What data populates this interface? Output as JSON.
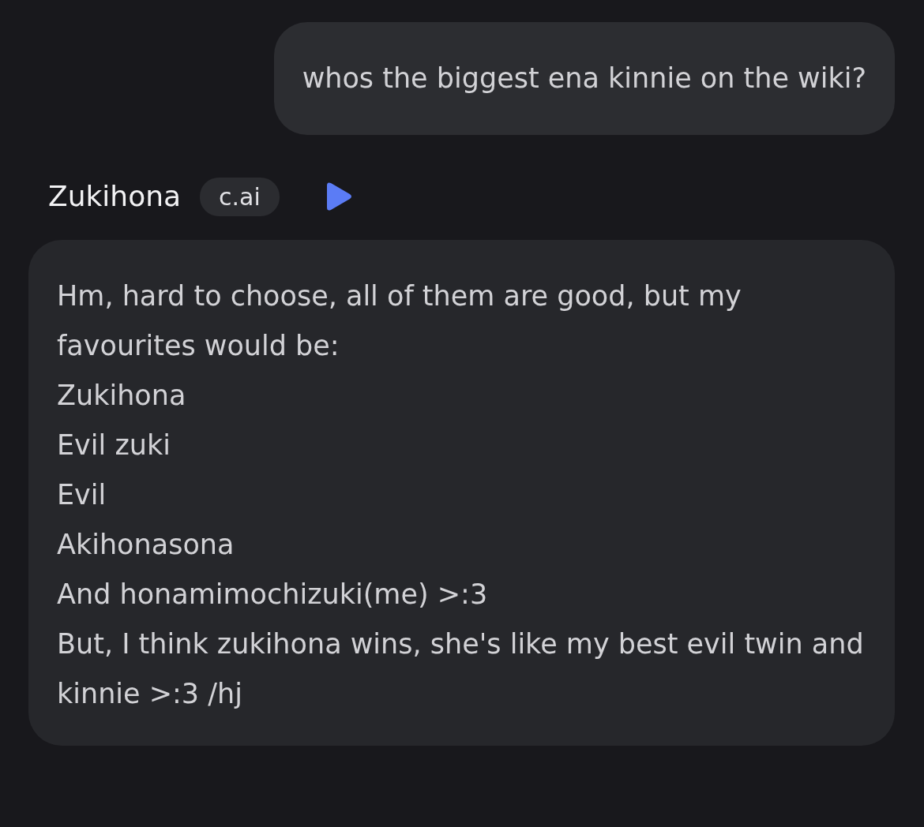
{
  "user_message": {
    "text": "whos the biggest ena kinnie on the wiki?"
  },
  "bot": {
    "name": "Zukihona",
    "badge": "c.ai",
    "lines": [
      "Hm, hard to choose, all of them are good, but my favourites would be:",
      "Zukihona",
      "Evil zuki",
      "Evil",
      "Akihonasona",
      "And honamimochizuki(me) >:3",
      "But, I think zukihona wins, she's like my best evil twin and kinnie >:3 /hj"
    ]
  }
}
